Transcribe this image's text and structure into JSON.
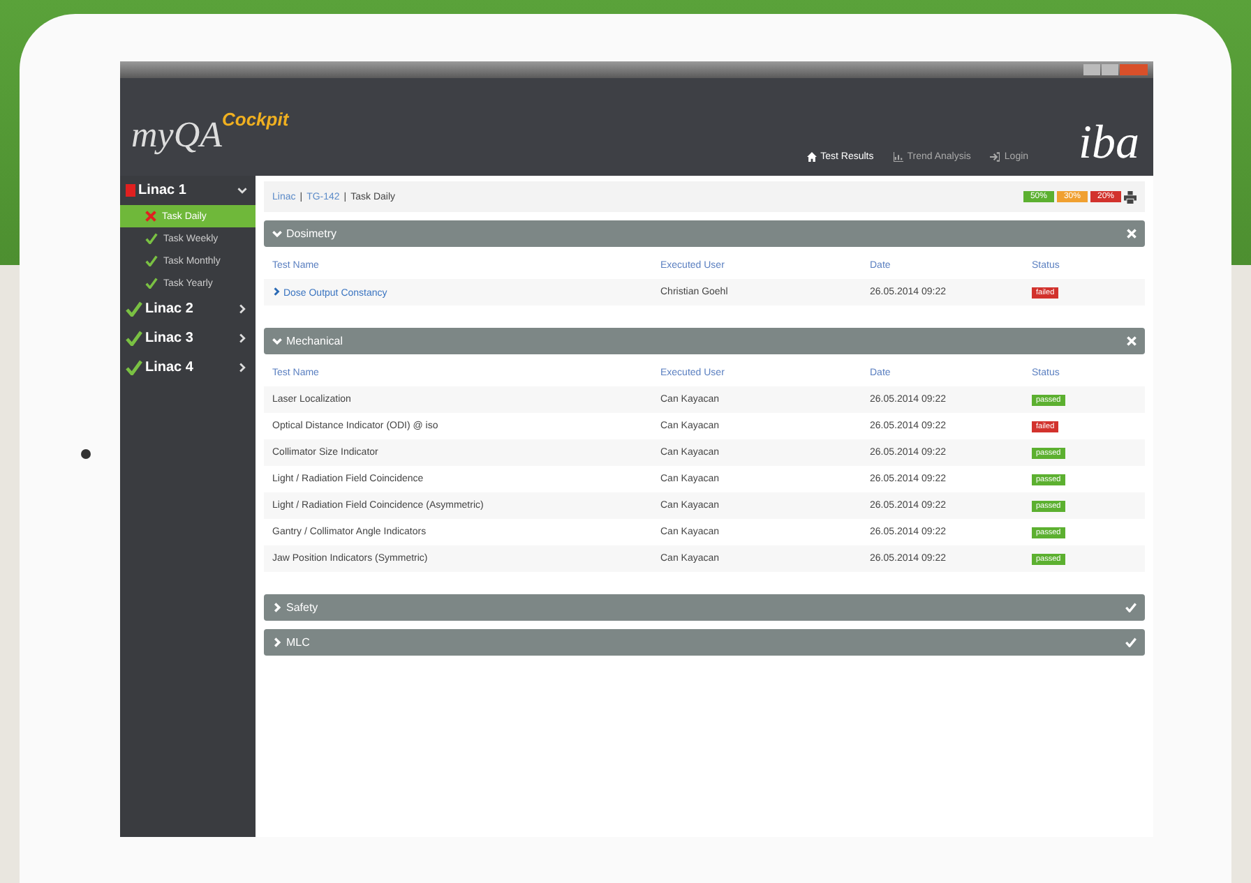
{
  "header": {
    "logo_main": "myQA",
    "logo_sub": "Cockpit",
    "brand": "iba",
    "nav": [
      {
        "label": "Test Results",
        "selected": true
      },
      {
        "label": "Trend Analysis",
        "selected": false
      },
      {
        "label": "Login",
        "selected": false
      }
    ]
  },
  "sidebar": {
    "items": [
      {
        "label": "Linac 1",
        "passed": false,
        "expanded": true,
        "children": [
          {
            "label": "Task Daily",
            "passed": false,
            "selected": true
          },
          {
            "label": "Task Weekly",
            "passed": true,
            "selected": false
          },
          {
            "label": "Task Monthly",
            "passed": true,
            "selected": false
          },
          {
            "label": "Task Yearly",
            "passed": true,
            "selected": false
          }
        ]
      },
      {
        "label": "Linac 2",
        "passed": true,
        "expanded": false
      },
      {
        "label": "Linac 3",
        "passed": true,
        "expanded": false
      },
      {
        "label": "Linac 4",
        "passed": true,
        "expanded": false
      }
    ]
  },
  "breadcrumb": {
    "separator": "|",
    "items": [
      {
        "label": "Linac",
        "link": true
      },
      {
        "label": "TG-142",
        "link": true
      },
      {
        "label": "Task Daily",
        "link": false
      }
    ]
  },
  "summary": [
    {
      "label": "50%",
      "kind": "passed"
    },
    {
      "label": "30%",
      "kind": "warning"
    },
    {
      "label": "20%",
      "kind": "failed"
    }
  ],
  "sections": [
    {
      "title": "Dosimetry",
      "expanded": true,
      "columns": [
        "Test Name",
        "Executed User",
        "Date",
        "Status"
      ],
      "rows": [
        {
          "name": "Dose Output Constancy",
          "expandable": true,
          "user": "Christian Goehl",
          "date": "26.05.2014 09:22",
          "status": "failed",
          "passed": false
        }
      ]
    },
    {
      "title": "Mechanical",
      "expanded": true,
      "columns": [
        "Test Name",
        "Executed User",
        "Date",
        "Status"
      ],
      "rows": [
        {
          "name": "Laser Localization",
          "expandable": false,
          "user": "Can Kayacan",
          "date": "26.05.2014 09:22",
          "status": "passed",
          "passed": true
        },
        {
          "name": "Optical Distance Indicator (ODI) @ iso",
          "expandable": false,
          "user": "Can Kayacan",
          "date": "26.05.2014 09:22",
          "status": "failed",
          "passed": false
        },
        {
          "name": "Collimator Size Indicator",
          "expandable": false,
          "user": "Can Kayacan",
          "date": "26.05.2014 09:22",
          "status": "passed",
          "passed": true
        },
        {
          "name": "Light / Radiation Field Coincidence",
          "expandable": false,
          "user": "Can Kayacan",
          "date": "26.05.2014 09:22",
          "status": "passed",
          "passed": true
        },
        {
          "name": "Light / Radiation Field Coincidence (Asymmetric)",
          "expandable": false,
          "user": "Can Kayacan",
          "date": "26.05.2014 09:22",
          "status": "passed",
          "passed": true
        },
        {
          "name": "Gantry / Collimator Angle Indicators",
          "expandable": false,
          "user": "Can Kayacan",
          "date": "26.05.2014 09:22",
          "status": "passed",
          "passed": true
        },
        {
          "name": "Jaw Position Indicators (Symmetric)",
          "expandable": false,
          "user": "Can Kayacan",
          "date": "26.05.2014 09:22",
          "status": "passed",
          "passed": true
        }
      ]
    },
    {
      "title": "Safety",
      "expanded": false
    },
    {
      "title": "MLC",
      "expanded": false
    }
  ]
}
